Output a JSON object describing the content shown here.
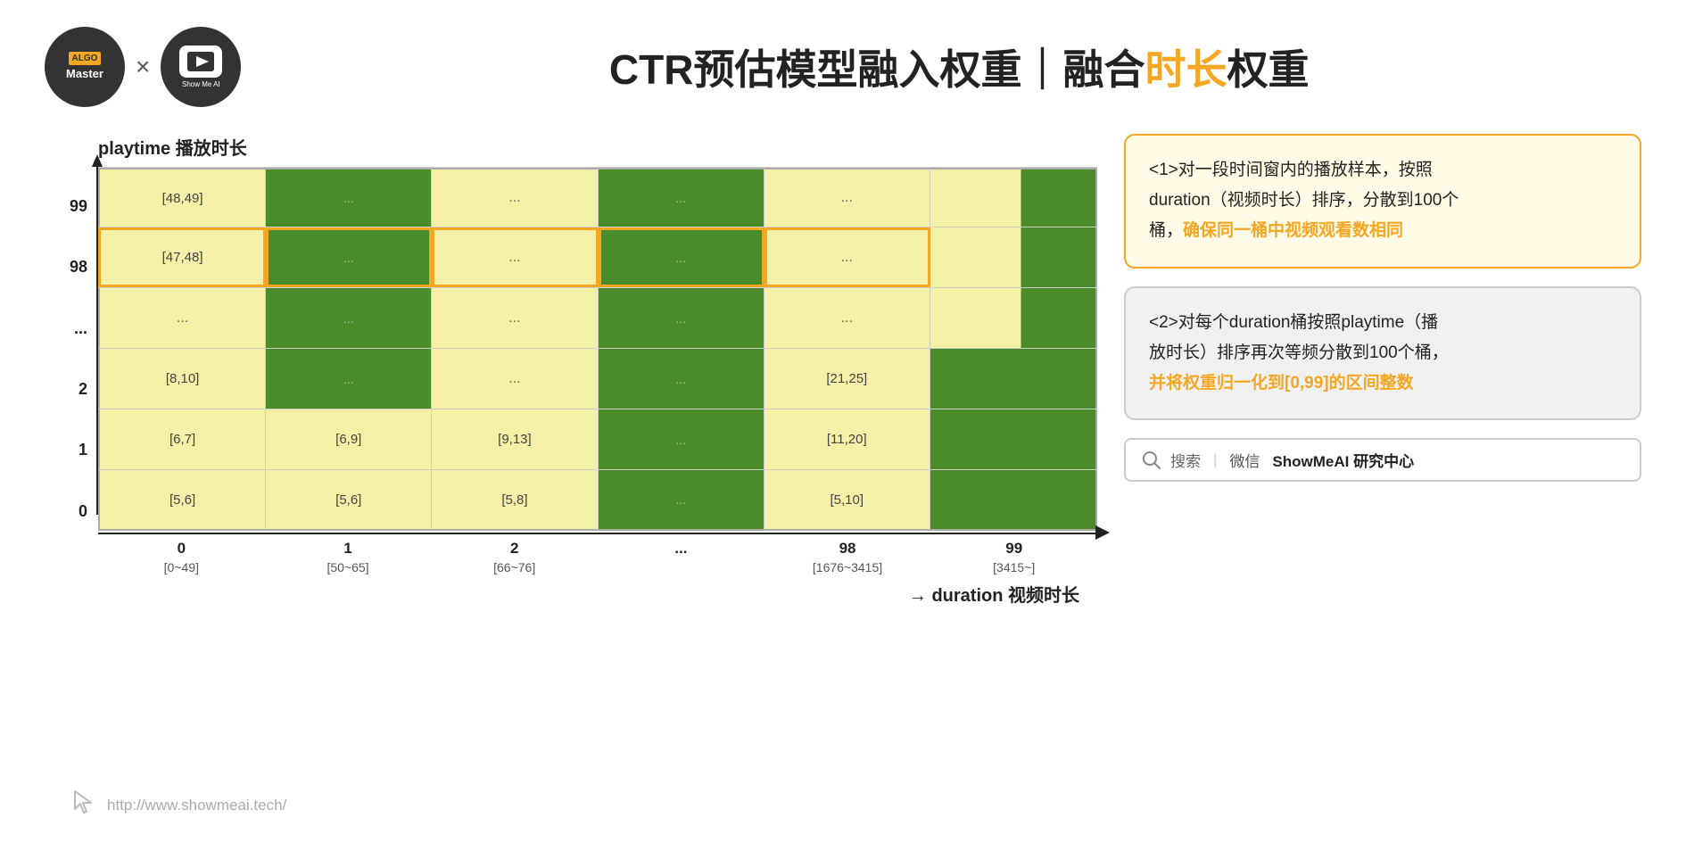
{
  "header": {
    "title_part1": "CTR预估模型融入权重｜融合",
    "title_highlight": "时长",
    "title_part2": "权重",
    "algo_logo": {
      "line1": "ALGO",
      "line2": "Master"
    },
    "showme_logo_text": "Show Me AI",
    "x_label": "×"
  },
  "chart": {
    "y_axis_label": "playtime 播放时长",
    "x_axis_label": "duration 视频时长",
    "y_ticks": [
      "99",
      "98",
      "...",
      "2",
      "1",
      "0"
    ],
    "x_ticks": [
      {
        "main": "0",
        "sub": "[0~49]"
      },
      {
        "main": "1",
        "sub": "[50~65]"
      },
      {
        "main": "2",
        "sub": "[66~76]"
      },
      {
        "main": "...",
        "sub": ""
      },
      {
        "main": "98",
        "sub": "[1676~3415]"
      },
      {
        "main": "99",
        "sub": "[3415~]"
      }
    ],
    "rows": [
      {
        "label": "99",
        "cells": [
          {
            "type": "light-yellow",
            "text": "[48,49]"
          },
          {
            "type": "green",
            "text": "..."
          },
          {
            "type": "light-yellow",
            "text": "..."
          },
          {
            "type": "green",
            "text": "..."
          },
          {
            "type": "light-yellow",
            "text": "..."
          },
          {
            "type": "light-yellow-partial-green",
            "text": ""
          }
        ]
      },
      {
        "label": "98",
        "cells": [
          {
            "type": "light-yellow",
            "text": "[47,48]",
            "orange_border": true
          },
          {
            "type": "green",
            "text": "...",
            "orange_border": true
          },
          {
            "type": "light-yellow",
            "text": "...",
            "orange_border": true
          },
          {
            "type": "green",
            "text": "...",
            "orange_border": true
          },
          {
            "type": "light-yellow",
            "text": "...",
            "orange_border": true
          },
          {
            "type": "light-yellow-partial-green",
            "text": ""
          }
        ]
      },
      {
        "label": "...",
        "cells": [
          {
            "type": "light-yellow",
            "text": "..."
          },
          {
            "type": "green",
            "text": "..."
          },
          {
            "type": "light-yellow",
            "text": "..."
          },
          {
            "type": "green",
            "text": "..."
          },
          {
            "type": "light-yellow",
            "text": "..."
          },
          {
            "type": "light-yellow-partial-green",
            "text": ""
          }
        ]
      },
      {
        "label": "2",
        "cells": [
          {
            "type": "light-yellow",
            "text": "[8,10]"
          },
          {
            "type": "green",
            "text": "..."
          },
          {
            "type": "light-yellow",
            "text": "..."
          },
          {
            "type": "green",
            "text": "..."
          },
          {
            "type": "light-yellow",
            "text": "[21,25]"
          },
          {
            "type": "green-full",
            "text": ""
          }
        ]
      },
      {
        "label": "1",
        "cells": [
          {
            "type": "light-yellow",
            "text": "[6,7]"
          },
          {
            "type": "light-yellow",
            "text": "[6,9]"
          },
          {
            "type": "light-yellow",
            "text": "[9,13]"
          },
          {
            "type": "green",
            "text": "..."
          },
          {
            "type": "light-yellow",
            "text": "[11,20]"
          },
          {
            "type": "green-full",
            "text": ""
          }
        ]
      },
      {
        "label": "0",
        "cells": [
          {
            "type": "light-yellow",
            "text": "[5,6]"
          },
          {
            "type": "light-yellow",
            "text": "[5,6]"
          },
          {
            "type": "light-yellow",
            "text": "[5,8]"
          },
          {
            "type": "green",
            "text": "..."
          },
          {
            "type": "light-yellow",
            "text": "[5,10]"
          },
          {
            "type": "green-full",
            "text": ""
          }
        ]
      }
    ]
  },
  "callout1": {
    "text1": "<l>对一段时间窗内的播放样本，按照",
    "text2": "duration（视频时长）排序，分散到100个",
    "text3": "桶，",
    "highlight": "确保同一桶中视频观看数相同",
    "number": "1"
  },
  "callout2": {
    "text1": "<2>对每个duration桶按照playtime（播",
    "text2": "放时长）排序再次等频分散到100个桶，",
    "highlight": "并将权重归一化到[0,99]的区间整数",
    "number": "2"
  },
  "search_box": {
    "icon": "search",
    "divider": "|",
    "label": "微信",
    "brand": "ShowMeAI 研究中心",
    "placeholder": "搜索"
  },
  "footer": {
    "url": "http://www.showmeai.tech/",
    "icon": "cursor"
  }
}
